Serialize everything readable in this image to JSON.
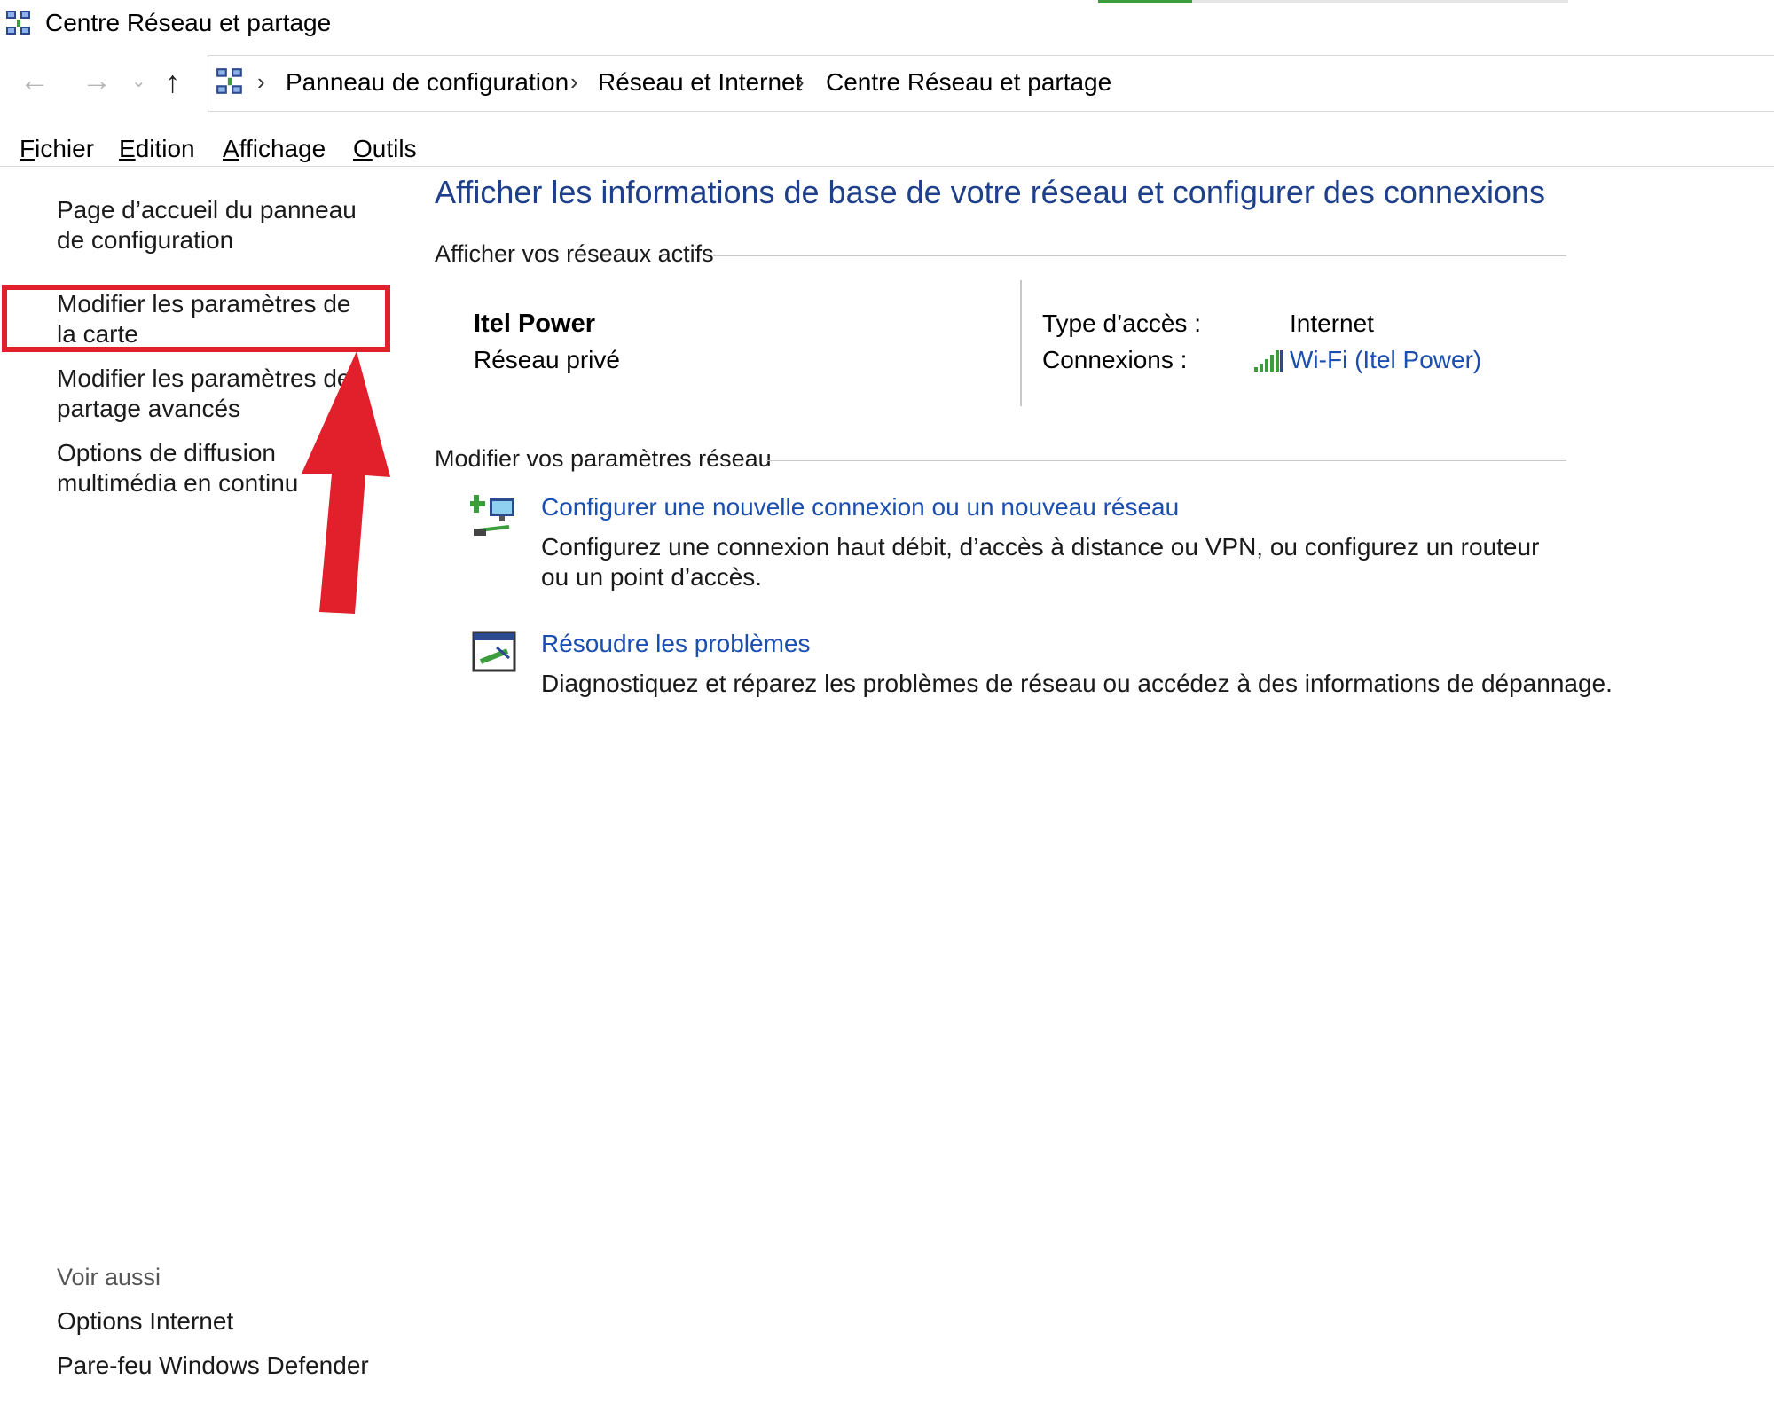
{
  "window": {
    "title": "Centre Réseau et partage"
  },
  "nav": {
    "back_icon": "←",
    "forward_icon": "→",
    "recent_icon": "⌄",
    "up_icon": "↑",
    "separator": "›",
    "breadcrumbs": [
      "Panneau de configuration",
      "Réseau et Internet",
      "Centre Réseau et partage"
    ]
  },
  "menu": [
    {
      "accel": "F",
      "rest": "ichier"
    },
    {
      "accel": "E",
      "rest": "dition"
    },
    {
      "accel": "A",
      "rest": "ffichage"
    },
    {
      "accel": "O",
      "rest": "utils"
    }
  ],
  "sidebar": {
    "links": [
      "Page d’accueil du panneau de configuration",
      "Modifier les paramètres de la carte",
      "Modifier les paramètres de partage avancés",
      "Options de diffusion multimédia en continu"
    ],
    "see_also": {
      "title": "Voir aussi",
      "links": [
        "Options Internet",
        "Pare-feu Windows Defender"
      ]
    }
  },
  "main": {
    "heading": "Afficher les informations de base de votre réseau et configurer des connexions",
    "active_section": "Afficher vos réseaux actifs",
    "network": {
      "name": "Itel Power",
      "type": "Réseau privé",
      "access_label": "Type d’accès :",
      "access_value": "Internet",
      "connections_label": "Connexions :",
      "connection_link": "Wi-Fi (Itel Power)"
    },
    "settings_section": "Modifier vos paramètres réseau",
    "tasks": [
      {
        "icon": "new-connection-icon",
        "link": "Configurer une nouvelle connexion ou un nouveau réseau",
        "description": "Configurez une connexion haut débit, d’accès à distance ou VPN, ou configurez un routeur ou un point d’accès."
      },
      {
        "icon": "troubleshoot-icon",
        "link": "Résoudre les problèmes",
        "description": "Diagnostiquez et réparez les problèmes de réseau ou accédez à des informations de dépannage."
      }
    ]
  },
  "annotation": {
    "color": "#e2202b"
  }
}
